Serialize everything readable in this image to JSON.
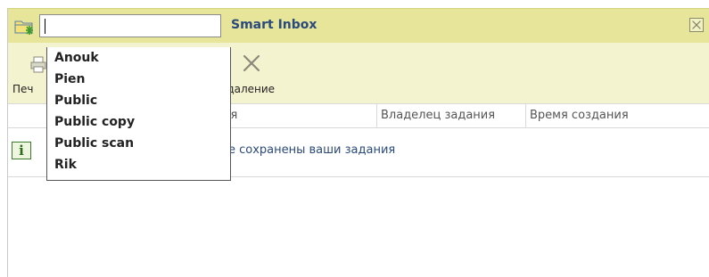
{
  "titlebar": {
    "title": "Smart Inbox",
    "search_value": ""
  },
  "toolbar": {
    "print_label": "Печ",
    "delete_label": "Удаление"
  },
  "table": {
    "columns": [
      "ия",
      "Владелец задания",
      "Время создания"
    ]
  },
  "info": {
    "text": "де сохранены ваши задания"
  },
  "dropdown": {
    "options": [
      "Anouk",
      "Pien",
      "Public",
      "Public copy",
      "Public scan",
      "Rik"
    ]
  },
  "colors": {
    "titlebar_bg": "#e7e59a",
    "toolbar_bg": "#f4f3cf",
    "title_text": "#2b4a7c"
  },
  "icons": {
    "folder": "folder-new-icon",
    "close": "close-icon",
    "print": "print-icon",
    "delete": "delete-x-icon",
    "info": "info-icon"
  }
}
